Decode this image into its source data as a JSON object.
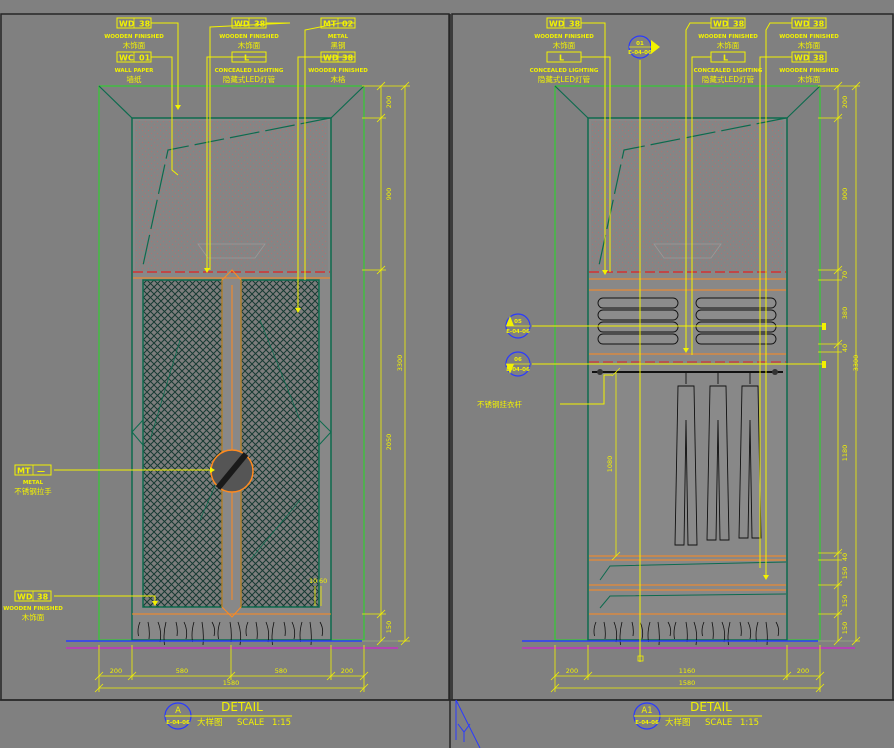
{
  "colors": {
    "background": "#808080",
    "annotation": "#f2f200",
    "frame": "#22dd22",
    "cabinet": "#0d6b4e",
    "wood": "#ff8a1e",
    "mesh": "#173a33",
    "floor": "#2a3aff",
    "magenta": "#d020d0",
    "red": "#e02020",
    "panel": "#909090"
  },
  "left_view": {
    "tags": [
      {
        "code": "WD",
        "num": "38",
        "en": "WOODEN FINISHED",
        "cn": "木饰面"
      },
      {
        "code": "WC",
        "num": "01",
        "en": "WALL PAPER",
        "cn": "墙纸"
      },
      {
        "code": "WD",
        "num": "38",
        "en": "WOODEN FINISHED",
        "cn": "木饰面"
      },
      {
        "code": "L",
        "num": "",
        "en": "CONCEALED LIGHTING",
        "cn": "隐藏式LED灯管"
      },
      {
        "code": "MT",
        "num": "02",
        "en": "METAL",
        "cn": "黑钢"
      },
      {
        "code": "WD",
        "num": "38",
        "en": "WOODEN FINISHED",
        "cn": "木格"
      },
      {
        "code": "MT",
        "num": "—",
        "en": "METAL",
        "cn": "不锈钢拉手"
      },
      {
        "code": "WD",
        "num": "38",
        "en": "WOODEN FINISHED",
        "cn": "木饰面"
      }
    ],
    "vertical_dims": [
      "200",
      "900",
      "3300",
      "2050",
      "150"
    ],
    "horizontal_dims": [
      "200",
      "580",
      "580",
      "200"
    ],
    "total_width": "1580",
    "small_dim": "10",
    "small_dim_b": "60",
    "title": {
      "letter": "A",
      "sheet": "E-04-06",
      "word": "DETAIL",
      "cn": "大样图",
      "scale_label": "SCALE",
      "scale": "1:15"
    }
  },
  "right_view": {
    "tags": [
      {
        "code": "WD",
        "num": "38",
        "en": "WOODEN FINISHED",
        "cn": "木饰面"
      },
      {
        "code": "L",
        "num": "",
        "en": "CONCEALED LIGHTING",
        "cn": "隐藏式LED灯管"
      },
      {
        "code": "WD",
        "num": "38",
        "en": "WOODEN FINISHED",
        "cn": "木饰面"
      },
      {
        "code": "L",
        "num": "",
        "en": "CONCEALED LIGHTING",
        "cn": "隐藏式LED灯管"
      },
      {
        "code": "WD",
        "num": "38",
        "en": "WOODEN FINISHED",
        "cn": "木饰面"
      },
      {
        "code": "WD",
        "num": "38",
        "en": "WOODEN FINISHED",
        "cn": "木饰面"
      }
    ],
    "section_marker": {
      "num": "01",
      "sheet": "E-04-06"
    },
    "callouts": [
      {
        "num": "05",
        "sheet": "E-04-06"
      },
      {
        "num": "06",
        "sheet": "E-04-06"
      }
    ],
    "rail_label": "不锈钢挂衣杆",
    "vertical_dims": [
      "200",
      "900",
      "70",
      "380",
      "40",
      "3300",
      "1180",
      "40",
      "150",
      "150",
      "150"
    ],
    "inner_dim": "1080",
    "horizontal_dims": [
      "200",
      "1160",
      "200"
    ],
    "total_width": "1580",
    "title": {
      "letter": "A1",
      "sheet": "E-04-06",
      "word": "DETAIL",
      "cn": "大样图",
      "scale_label": "SCALE",
      "scale": "1:15"
    }
  }
}
